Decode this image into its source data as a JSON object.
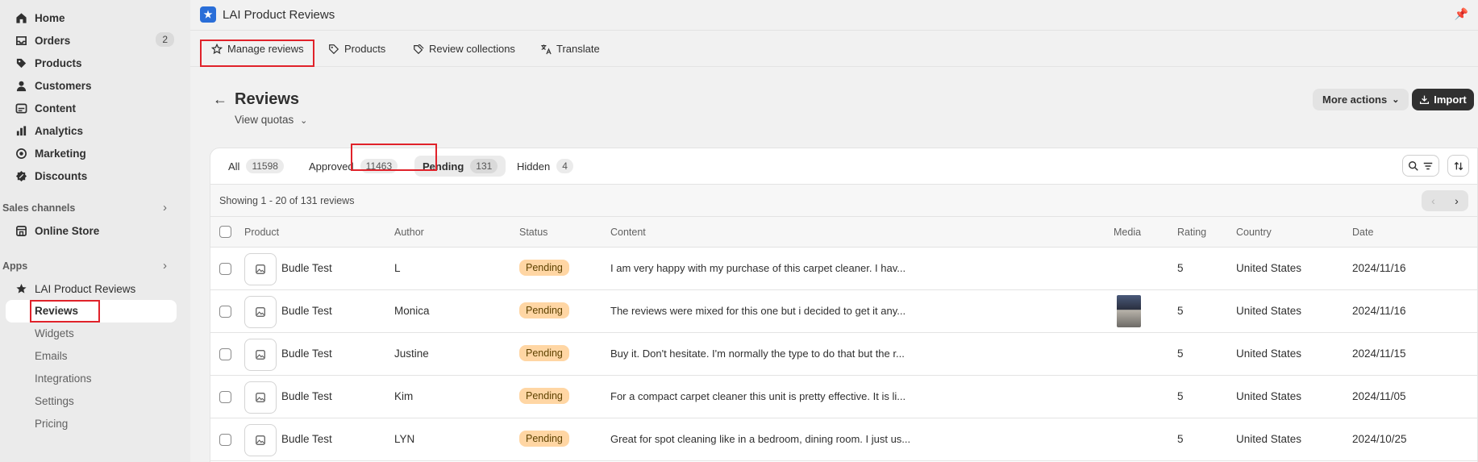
{
  "sidebar": {
    "items": [
      {
        "label": "Home",
        "icon": "home-icon"
      },
      {
        "label": "Orders",
        "icon": "inbox-icon",
        "badge": "2"
      },
      {
        "label": "Products",
        "icon": "tag-icon"
      },
      {
        "label": "Customers",
        "icon": "person-icon"
      },
      {
        "label": "Content",
        "icon": "content-icon"
      },
      {
        "label": "Analytics",
        "icon": "bar-chart-icon"
      },
      {
        "label": "Marketing",
        "icon": "target-icon"
      },
      {
        "label": "Discounts",
        "icon": "discount-icon"
      }
    ],
    "sales_channels_label": "Sales channels",
    "online_store": "Online Store",
    "apps_label": "Apps",
    "app_name": "LAI Product Reviews",
    "app_sub_items": [
      "Reviews",
      "Widgets",
      "Emails",
      "Integrations",
      "Settings",
      "Pricing"
    ]
  },
  "header": {
    "app_title": "LAI Product Reviews"
  },
  "app_nav": {
    "items": [
      {
        "label": "Manage reviews",
        "icon": "star-icon"
      },
      {
        "label": "Products",
        "icon": "tag-icon"
      },
      {
        "label": "Review collections",
        "icon": "tags-icon"
      },
      {
        "label": "Translate",
        "icon": "translate-icon"
      }
    ]
  },
  "page": {
    "title": "Reviews",
    "view_quotas": "View quotas",
    "more_actions": "More actions",
    "import": "Import"
  },
  "filters": [
    {
      "label": "All",
      "count": "11598"
    },
    {
      "label": "Approved",
      "count": "11463"
    },
    {
      "label": "Pending",
      "count": "131",
      "active": true
    },
    {
      "label": "Hidden",
      "count": "4"
    }
  ],
  "table": {
    "showing": "Showing 1 - 20 of 131 reviews",
    "columns": [
      "Product",
      "Author",
      "Status",
      "Content",
      "Media",
      "Rating",
      "Country",
      "Date"
    ],
    "rows": [
      {
        "product": "Budle Test",
        "author": "L",
        "status": "Pending",
        "content": "I am very happy with my purchase of this carpet cleaner. I hav...",
        "media": false,
        "rating": "5",
        "country": "United States",
        "date": "2024/11/16"
      },
      {
        "product": "Budle Test",
        "author": "Monica",
        "status": "Pending",
        "content": "The reviews were mixed for this one but i decided to get it any...",
        "media": true,
        "rating": "5",
        "country": "United States",
        "date": "2024/11/16"
      },
      {
        "product": "Budle Test",
        "author": "Justine",
        "status": "Pending",
        "content": "Buy it. Don't hesitate. I'm normally the type to do that but the r...",
        "media": false,
        "rating": "5",
        "country": "United States",
        "date": "2024/11/15"
      },
      {
        "product": "Budle Test",
        "author": "Kim",
        "status": "Pending",
        "content": "For a compact carpet cleaner this unit is pretty effective. It is li...",
        "media": false,
        "rating": "5",
        "country": "United States",
        "date": "2024/11/05"
      },
      {
        "product": "Budle Test",
        "author": "LYN",
        "status": "Pending",
        "content": "Great for spot cleaning like in a bedroom, dining room. I just us...",
        "media": false,
        "rating": "5",
        "country": "United States",
        "date": "2024/10/25"
      }
    ]
  },
  "colors": {
    "pending_bg": "#ffd6a4",
    "highlight": "#e0222a",
    "app_logo": "#2a6ed8"
  }
}
